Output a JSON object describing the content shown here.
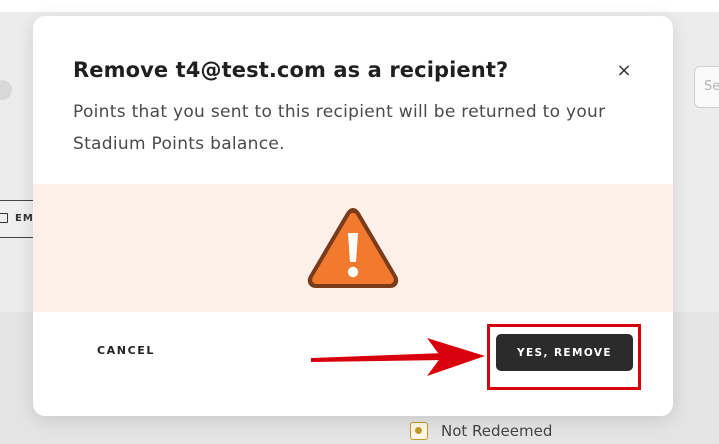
{
  "modal": {
    "title": "Remove t4@test.com as a recipient?",
    "close_glyph": "×",
    "close_icon": "close-icon",
    "body": "Points that you sent to this recipient will be returned to your Stadium Points balance.",
    "warning_icon": "warning-triangle-icon",
    "cancel_label": "CANCEL",
    "confirm_label": "YES, REMOVE"
  },
  "background": {
    "email_button_label": "EM",
    "search_placeholder": "Se",
    "status_label": "Not Redeemed"
  },
  "colors": {
    "warning_fill": "#f27a2e",
    "warning_band": "#fdf0e8",
    "confirm_button_bg": "#2b2b2b",
    "annotation_red": "#d8000c",
    "status_accent": "#c49a2e"
  }
}
